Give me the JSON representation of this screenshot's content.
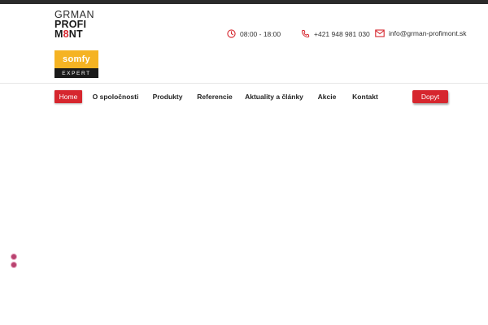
{
  "header": {
    "logo": {
      "line1": "GRMAN",
      "line2": "PROFI",
      "line3a": "M",
      "line3b": "NT"
    },
    "partner_logo": {
      "brand": "somfy",
      "label": "EXPERT"
    },
    "hours": "08:00 - 18:00",
    "phone": "+421 948 981 030",
    "email": "info@grman-profimont.sk"
  },
  "nav": {
    "items": [
      {
        "label": "Home",
        "active": true
      },
      {
        "label": "O spoločnosti"
      },
      {
        "label": "Produkty"
      },
      {
        "label": "Referencie"
      },
      {
        "label": "Aktuality a články"
      },
      {
        "label": "Akcie"
      },
      {
        "label": "Kontakt"
      }
    ],
    "cta_label": "Dopyt"
  },
  "colors": {
    "accent": "#d6262e",
    "somfy_yellow": "#f5b323",
    "dark": "#2b2b2b",
    "dot": "#b8426f"
  },
  "icons": [
    "clock-icon",
    "phone-icon",
    "envelope-icon"
  ]
}
